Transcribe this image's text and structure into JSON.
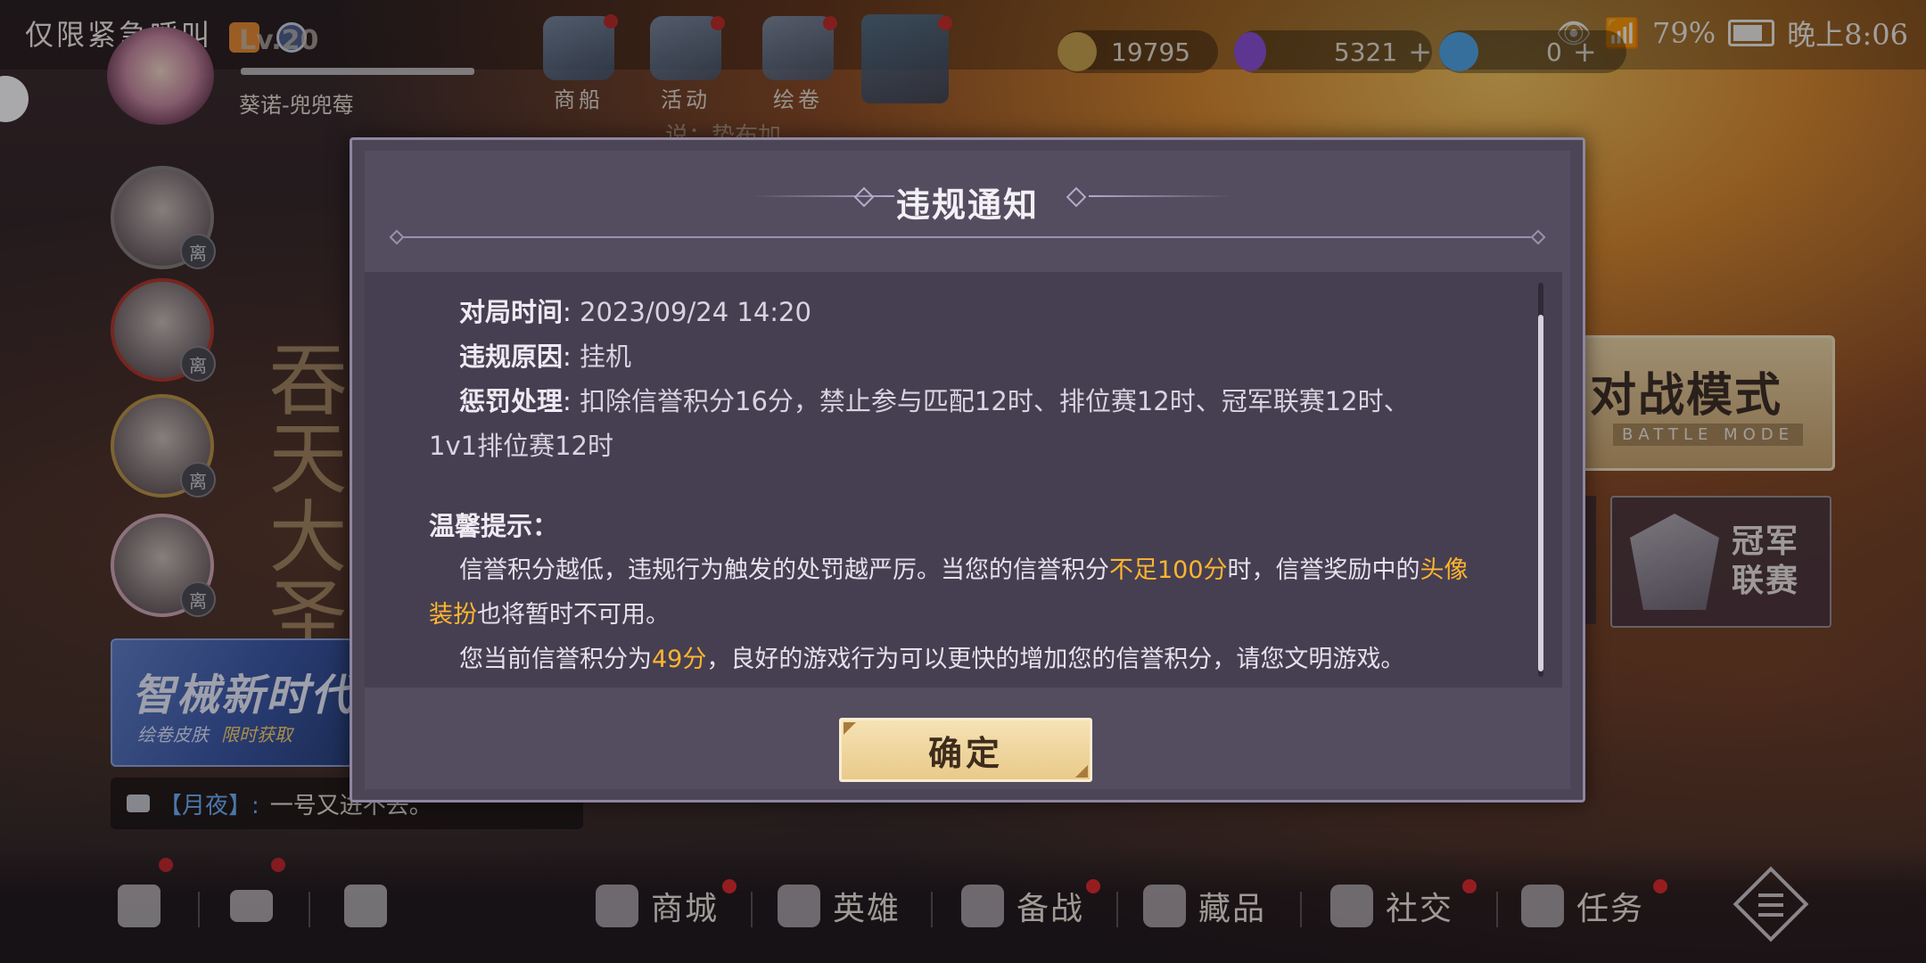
{
  "status_bar": {
    "left_text": "仅限紧急呼叫",
    "battery": "79%",
    "time": "晚上8:06"
  },
  "header": {
    "level": "Lv.20",
    "player_name": "葵诺-兜兜莓",
    "nav": [
      {
        "label": "商船",
        "icon": "ship-icon"
      },
      {
        "label": "活动",
        "icon": "megaphone-icon"
      },
      {
        "label": "绘卷",
        "icon": "scroll-icon"
      }
    ],
    "currency": [
      {
        "icon": "gold-coin-icon",
        "value": "19795",
        "color": "#c9a24a"
      },
      {
        "icon": "purple-gem-icon",
        "value": "5321",
        "color": "#8a4fd8"
      },
      {
        "icon": "blue-crystal-icon",
        "value": "0",
        "color": "#4fa6e8"
      }
    ],
    "ticker": "说：势布加"
  },
  "side": {
    "avatar_tag": "离",
    "calligraphy": "吞天大圣",
    "banner_title": "智械新时代",
    "banner_sub": "绘卷皮肤",
    "banner_limited": "限时获取",
    "chat_sender": "【月夜】:",
    "chat_message": "一号又进不去。"
  },
  "right": {
    "battle_mode_cn": "对战模式",
    "battle_mode_en": "BATTLE MODE",
    "champ_label_1": "冠军",
    "champ_label_2": "联赛"
  },
  "bottom_nav": [
    {
      "label": "商城",
      "icon": "shop-icon"
    },
    {
      "label": "英雄",
      "icon": "hero-icon"
    },
    {
      "label": "备战",
      "icon": "prepare-icon"
    },
    {
      "label": "藏品",
      "icon": "collection-icon"
    },
    {
      "label": "社交",
      "icon": "social-icon"
    },
    {
      "label": "任务",
      "icon": "task-icon"
    }
  ],
  "modal": {
    "title": "违规通知",
    "match_time_label": "对局时间",
    "match_time_value": "2023/09/24 14:20",
    "reason_label": "违规原因",
    "reason_value": "挂机",
    "penalty_label": "惩罚处理",
    "penalty_value_1": "扣除信誉积分16分，禁止参与匹配12时、排位赛12时、冠军联赛12时、",
    "penalty_value_2": "1v1排位赛12时",
    "tip_heading": "温馨提示：",
    "tip1_a": "信誉积分越低，违规行为触发的处罚越严厉。当您的信誉积分",
    "tip1_hl1": "不足100分",
    "tip1_b": "时，信誉奖励中的",
    "tip1_hl2": "头像",
    "tip1_hl3": "装扮",
    "tip1_c": "也将暂时不可用。",
    "tip2_a": "您当前信誉积分为",
    "tip2_hl": "49分",
    "tip2_b": "，良好的游戏行为可以更快的增加您的信誉积分，请您文明游戏。",
    "ok_label": "确定",
    "highlight_color": "#ffb52e"
  }
}
